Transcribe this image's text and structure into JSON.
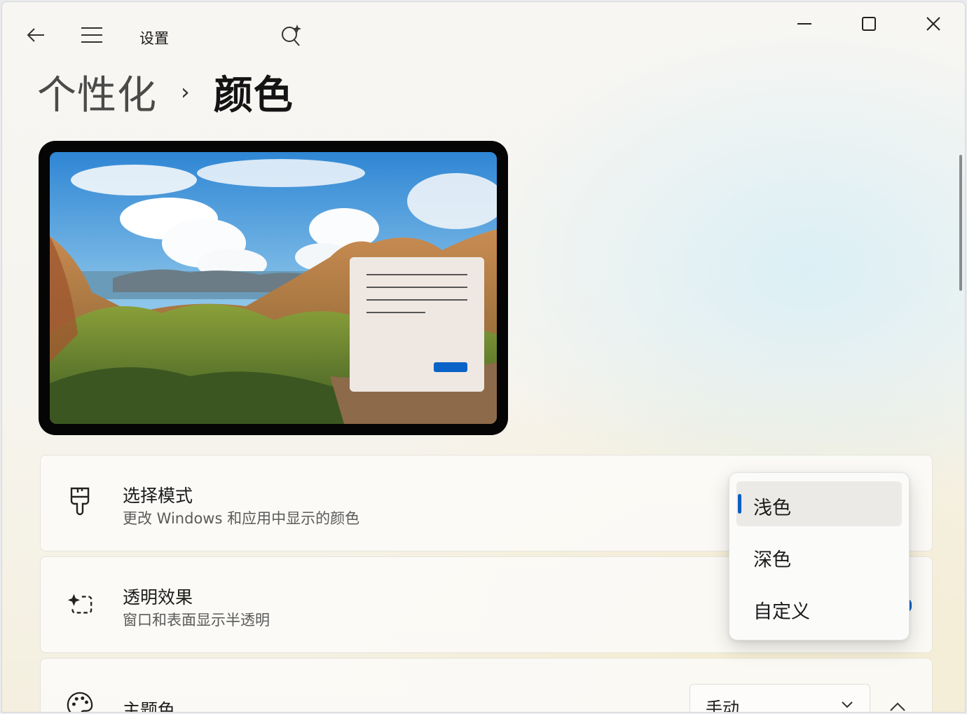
{
  "app": {
    "title": "设置"
  },
  "breadcrumb": {
    "parent": "个性化",
    "separator": "›",
    "current": "颜色"
  },
  "settings": {
    "mode": {
      "title": "选择模式",
      "description": "更改 Windows 和应用中显示的颜色"
    },
    "transparency": {
      "title": "透明效果",
      "description": "窗口和表面显示半透明"
    },
    "accent": {
      "title": "主题色",
      "dropdown_value": "手动"
    }
  },
  "mode_popup": {
    "options": [
      {
        "label": "浅色",
        "selected": true
      },
      {
        "label": "深色",
        "selected": false
      },
      {
        "label": "自定义",
        "selected": false
      }
    ]
  },
  "colors": {
    "accent": "#0a5fc2",
    "preview_button": "#0a63c6"
  },
  "icons": {
    "back": "back-arrow-icon",
    "menu": "hamburger-menu-icon",
    "copilot": "copilot-search-icon",
    "minimize": "minimize-icon",
    "maximize": "maximize-icon",
    "close": "close-icon",
    "mode": "paintbrush-icon",
    "transparency": "sparkle-selection-icon",
    "accent": "palette-icon"
  }
}
